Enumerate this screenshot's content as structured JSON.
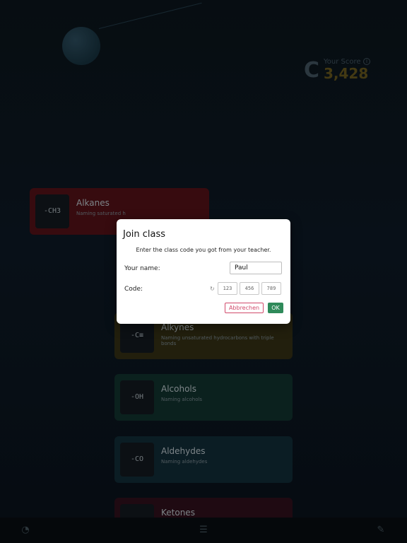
{
  "background": {
    "score_label": "Your Score",
    "score_grade": "C",
    "score_value": "3,428",
    "info_icon": "info-icon"
  },
  "topics": [
    {
      "title": "Alkanes",
      "desc": "Naming saturated h",
      "icon": "-CH3"
    },
    {
      "title": "Alkynes",
      "desc": "Naming unsaturated hydrocarbons with triple bonds",
      "icon": "-C≡"
    },
    {
      "title": "Alcohols",
      "desc": "Naming alcohols",
      "icon": "-OH"
    },
    {
      "title": "Aldehydes",
      "desc": "Naming aldehydes",
      "icon": "-CO"
    },
    {
      "title": "Ketones",
      "desc": "",
      "icon": "<>"
    }
  ],
  "modal": {
    "title": "Join class",
    "subtitle": "Enter the class code you got from your teacher.",
    "name_label": "Your name:",
    "name_value": "Paul",
    "code_label": "Code:",
    "code_placeholders": [
      "123",
      "456",
      "789"
    ],
    "cancel_label": "Abbrechen",
    "ok_label": "OK"
  },
  "bottom_bar": {
    "left_icon": "pie-chart-icon",
    "center_icon": "menu-icon",
    "right_icon": "edit-icon"
  }
}
